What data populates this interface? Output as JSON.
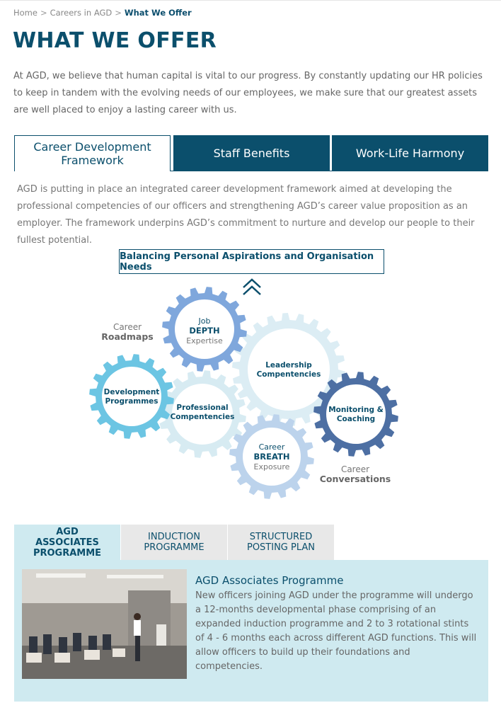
{
  "breadcrumb": {
    "home": "Home",
    "separator": ">",
    "careers": "Careers in AGD",
    "current": "What We Offer"
  },
  "page_title": "WHAT WE OFFER",
  "intro": "At AGD, we believe that human capital is vital to our progress. By constantly updating our HR policies to keep in tandem with the evolving needs of our employees, we make sure that our greatest assets are well placed to enjoy a lasting career with us.",
  "tabs": [
    {
      "label": "Career Development Framework",
      "active": true
    },
    {
      "label": "Staff Benefits",
      "active": false
    },
    {
      "label": "Work-Life Harmony",
      "active": false
    }
  ],
  "framework_text": "AGD is putting in place an integrated career development framework aimed at developing the professional competencies of our officers and strengthening AGD’s career value proposition as an employer. The framework underpins AGD’s commitment to nurture and develop our people to their fullest potential.",
  "diagram": {
    "banner": "Balancing Personal Aspirations and Organisation Needs",
    "gears": {
      "job": {
        "line1": "Job",
        "line2": "DEPTH",
        "line3": "Expertise"
      },
      "leadership": {
        "line1": "Leadership",
        "line2": "Compentencies"
      },
      "development": {
        "line1": "Development",
        "line2": "Programmes"
      },
      "professional": {
        "line1": "Professional",
        "line2": "Compentencies"
      },
      "monitoring": {
        "line1": "Monitoring &",
        "line2": "Coaching"
      },
      "career": {
        "line1": "Career",
        "line2": "BREATH",
        "line3": "Exposure"
      }
    },
    "labels": {
      "roadmaps": {
        "line1": "Career",
        "line2": "Roadmaps"
      },
      "conversations": {
        "line1": "Career",
        "line2": "Conversations"
      }
    },
    "colors": {
      "job": "#7fa7dc",
      "leadership": "#dcedf4",
      "development": "#6cc5e3",
      "professional": "#d7ebf2",
      "monitoring": "#4d6fa3",
      "career": "#bcd3ec"
    }
  },
  "programme_tabs": [
    {
      "label": "AGD ASSOCIATES PROGRAMME",
      "active": true
    },
    {
      "label": "INDUCTION PROGRAMME",
      "active": false
    },
    {
      "label": "STRUCTURED POSTING PLAN",
      "active": false
    }
  ],
  "programme": {
    "title": "AGD Associates Programme",
    "text": "New officers joining AGD under the programme will undergo a 12-months developmental phase comprising of an expanded induction programme and 2 to 3 rotational stints of 4 - 6 months each across different AGD functions. This will allow officers to build up their foundations and competencies."
  }
}
